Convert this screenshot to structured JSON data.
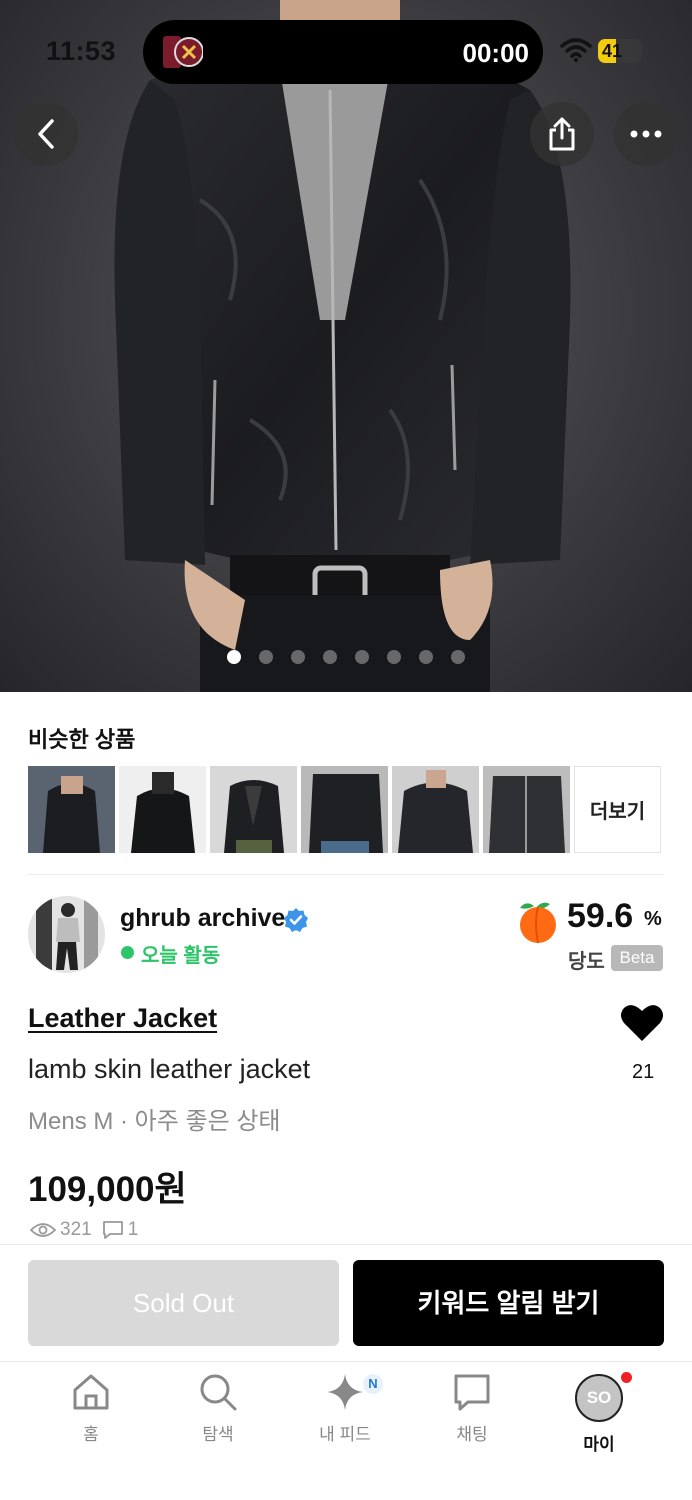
{
  "status_bar": {
    "time": "11:53",
    "timer": "00:00",
    "battery_level": "41",
    "battery_fraction": 0.41
  },
  "hero": {
    "image_count": 8,
    "active_index": 0
  },
  "similar": {
    "title": "비슷한 상품",
    "more_label": "더보기",
    "thumbnails": [
      "thumb-1",
      "thumb-2",
      "thumb-3",
      "thumb-4",
      "thumb-5",
      "thumb-6"
    ]
  },
  "seller": {
    "name": "ghrub archive",
    "activity": "오늘 활동",
    "sweetness_value": "59.6",
    "sweetness_unit": "%",
    "sweetness_label": "당도",
    "beta_label": "Beta"
  },
  "product": {
    "title": "Leather Jacket",
    "subtitle": "lamb skin leather jacket",
    "meta": "Mens M · 아주 좋은 상태",
    "price": "109,000원",
    "likes": "21",
    "views": "321",
    "comments": "1"
  },
  "actions": {
    "sold_out": "Sold Out",
    "keyword_alert": "키워드 알림 받기"
  },
  "tabbar": {
    "items": [
      {
        "label": "홈",
        "icon": "home-icon"
      },
      {
        "label": "탐색",
        "icon": "search-icon"
      },
      {
        "label": "내 피드",
        "icon": "sparkle-icon",
        "badge": "N"
      },
      {
        "label": "채팅",
        "icon": "chat-icon"
      },
      {
        "label": "마이",
        "icon": "avatar-icon",
        "avatar_text": "SO"
      }
    ],
    "selected": "마이"
  },
  "colors": {
    "accent_green": "#2ec46a",
    "sold_out_bg": "#d9d9d9",
    "primary_button": "#000000",
    "verified_blue": "#3d95ea",
    "notification_red": "#ee2222"
  }
}
